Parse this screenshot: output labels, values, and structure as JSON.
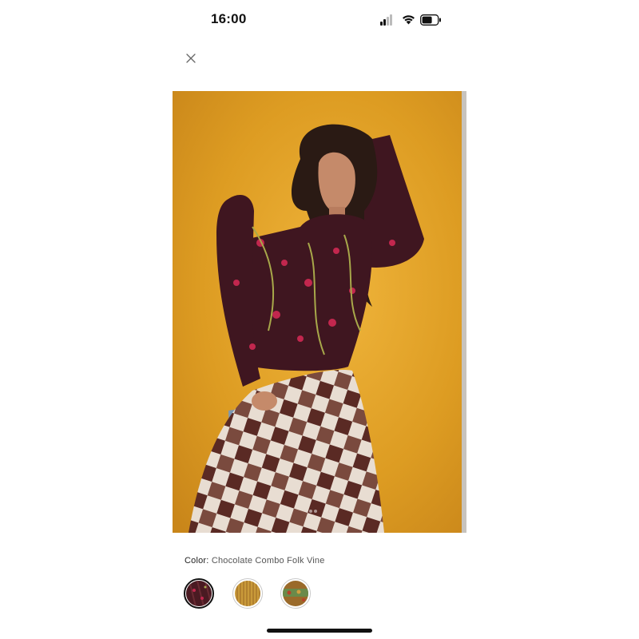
{
  "status_bar": {
    "time": "16:00",
    "icons": [
      "signal-icon",
      "wifi-icon",
      "battery-icon"
    ]
  },
  "header": {
    "close_icon": "close-icon"
  },
  "product": {
    "image_background": "#d99a1f",
    "image_page_dots": 2
  },
  "color_selector": {
    "label": "Color:",
    "selected_value": "Chocolate Combo Folk Vine",
    "swatches": [
      {
        "name": "Chocolate Combo Folk Vine",
        "color": "#4a1a22",
        "selected": true
      },
      {
        "name": "swatch-2",
        "color": "#c99a3a",
        "selected": false
      },
      {
        "name": "swatch-3",
        "color": "#9a6a2a",
        "selected": false
      }
    ]
  },
  "colors": {
    "background": "#ffffff",
    "text": "#222222",
    "muted_text": "#555555",
    "selected_border": "#111111"
  }
}
